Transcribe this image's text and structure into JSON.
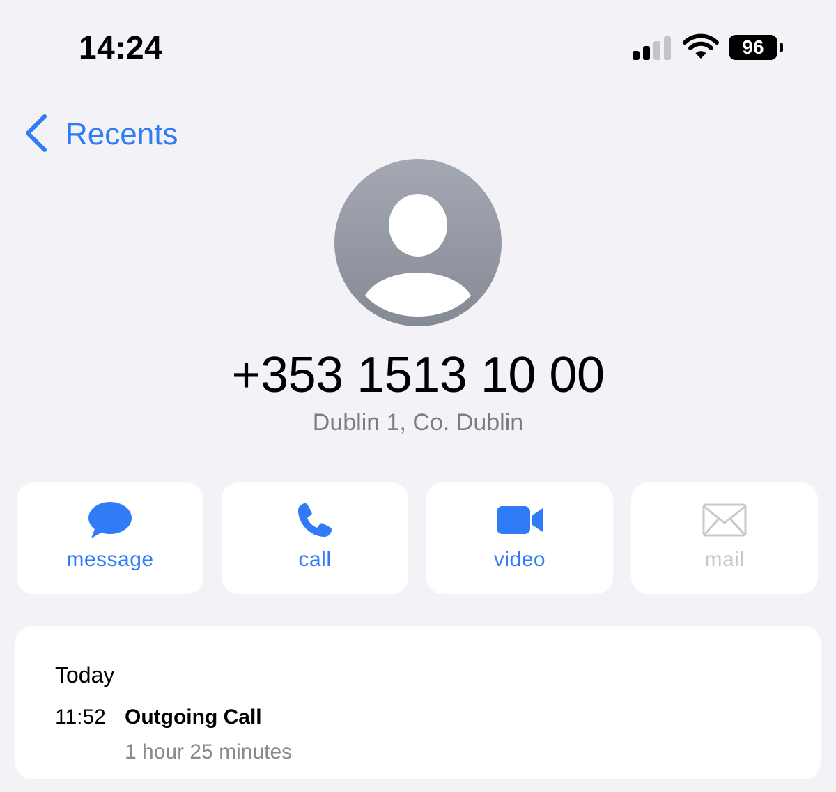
{
  "status_bar": {
    "time": "14:24",
    "battery": "96",
    "signal_icon": "signal-bars-icon",
    "wifi_icon": "wifi-icon"
  },
  "nav": {
    "back_label": "Recents",
    "back_icon": "chevron-left-icon"
  },
  "contact": {
    "avatar_icon": "person-placeholder-icon",
    "phone_number": "+353 1513 10 00",
    "location": "Dublin 1, Co. Dublin"
  },
  "actions": [
    {
      "label": "message",
      "icon": "message-bubble-icon",
      "enabled": true
    },
    {
      "label": "call",
      "icon": "phone-icon",
      "enabled": true
    },
    {
      "label": "video",
      "icon": "video-camera-icon",
      "enabled": true
    },
    {
      "label": "mail",
      "icon": "envelope-icon",
      "enabled": false
    }
  ],
  "history": {
    "day": "Today",
    "entries": [
      {
        "time": "11:52",
        "type": "Outgoing Call",
        "duration": "1 hour 25 minutes"
      }
    ]
  },
  "colors": {
    "accent": "#2f7cf6",
    "background": "#f2f2f7",
    "disabled": "#c8c8cc",
    "secondary_text": "#7c7c81"
  }
}
